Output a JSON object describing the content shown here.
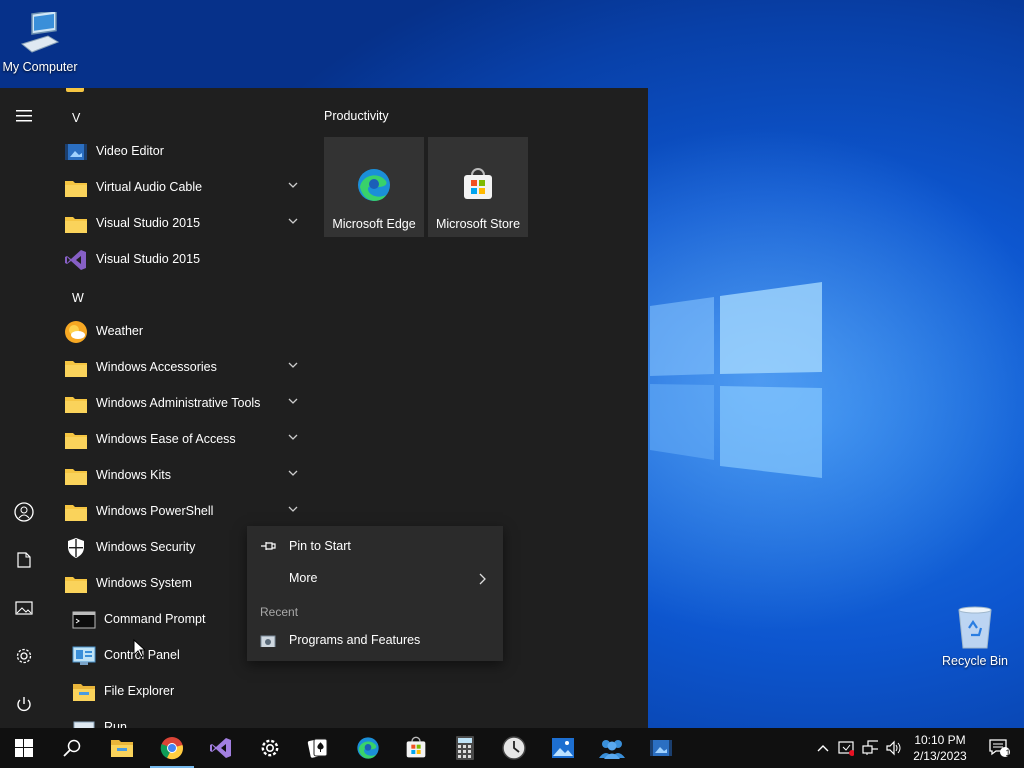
{
  "desktop": {
    "icons": [
      {
        "label": "My Computer",
        "icon": "computer-icon"
      },
      {
        "label": "Recycle Bin",
        "icon": "recycle-bin-icon"
      }
    ]
  },
  "start_menu": {
    "rail": [
      "menu-icon",
      "user-icon",
      "documents-icon",
      "pictures-icon",
      "settings-icon",
      "power-icon"
    ],
    "sections": [
      {
        "letter": "V",
        "items": [
          {
            "label": "Video Editor",
            "icon": "video-editor-icon"
          },
          {
            "label": "Virtual Audio Cable",
            "icon": "folder-icon",
            "expandable": true
          },
          {
            "label": "Visual Studio 2015",
            "icon": "folder-icon",
            "expandable": true
          },
          {
            "label": "Visual Studio 2015",
            "icon": "visual-studio-icon"
          }
        ]
      },
      {
        "letter": "W",
        "items": [
          {
            "label": "Weather",
            "icon": "weather-icon"
          },
          {
            "label": "Windows Accessories",
            "icon": "folder-icon",
            "expandable": true
          },
          {
            "label": "Windows Administrative Tools",
            "icon": "folder-icon",
            "expandable": true
          },
          {
            "label": "Windows Ease of Access",
            "icon": "folder-icon",
            "expandable": true
          },
          {
            "label": "Windows Kits",
            "icon": "folder-icon",
            "expandable": true
          },
          {
            "label": "Windows PowerShell",
            "icon": "folder-icon",
            "expandable": true
          },
          {
            "label": "Windows Security",
            "icon": "shield-icon"
          },
          {
            "label": "Windows System",
            "icon": "folder-icon",
            "expanded": true
          }
        ]
      }
    ],
    "subitems": [
      {
        "label": "Command Prompt",
        "icon": "command-prompt-icon"
      },
      {
        "label": "Control Panel",
        "icon": "control-panel-icon"
      },
      {
        "label": "File Explorer",
        "icon": "file-explorer-icon"
      },
      {
        "label": "Run",
        "icon": "run-icon"
      }
    ],
    "tile_group": {
      "title": "Productivity",
      "tiles": [
        {
          "label": "Microsoft Edge",
          "icon": "edge-icon"
        },
        {
          "label": "Microsoft Store",
          "icon": "store-icon"
        }
      ]
    }
  },
  "context_menu": {
    "pin_label": "Pin to Start",
    "more_label": "More",
    "recent_header": "Recent",
    "recent_item": "Programs and Features"
  },
  "taskbar": {
    "apps": [
      "start-icon",
      "search-icon",
      "file-explorer-icon",
      "chrome-icon",
      "visual-studio-icon",
      "settings-icon",
      "solitaire-icon",
      "edge-icon",
      "store-icon",
      "calculator-icon",
      "clock-icon",
      "photos-icon",
      "people-icon",
      "video-editor-icon"
    ],
    "time": "10:10 PM",
    "date": "2/13/2023",
    "notification_count": "1"
  }
}
